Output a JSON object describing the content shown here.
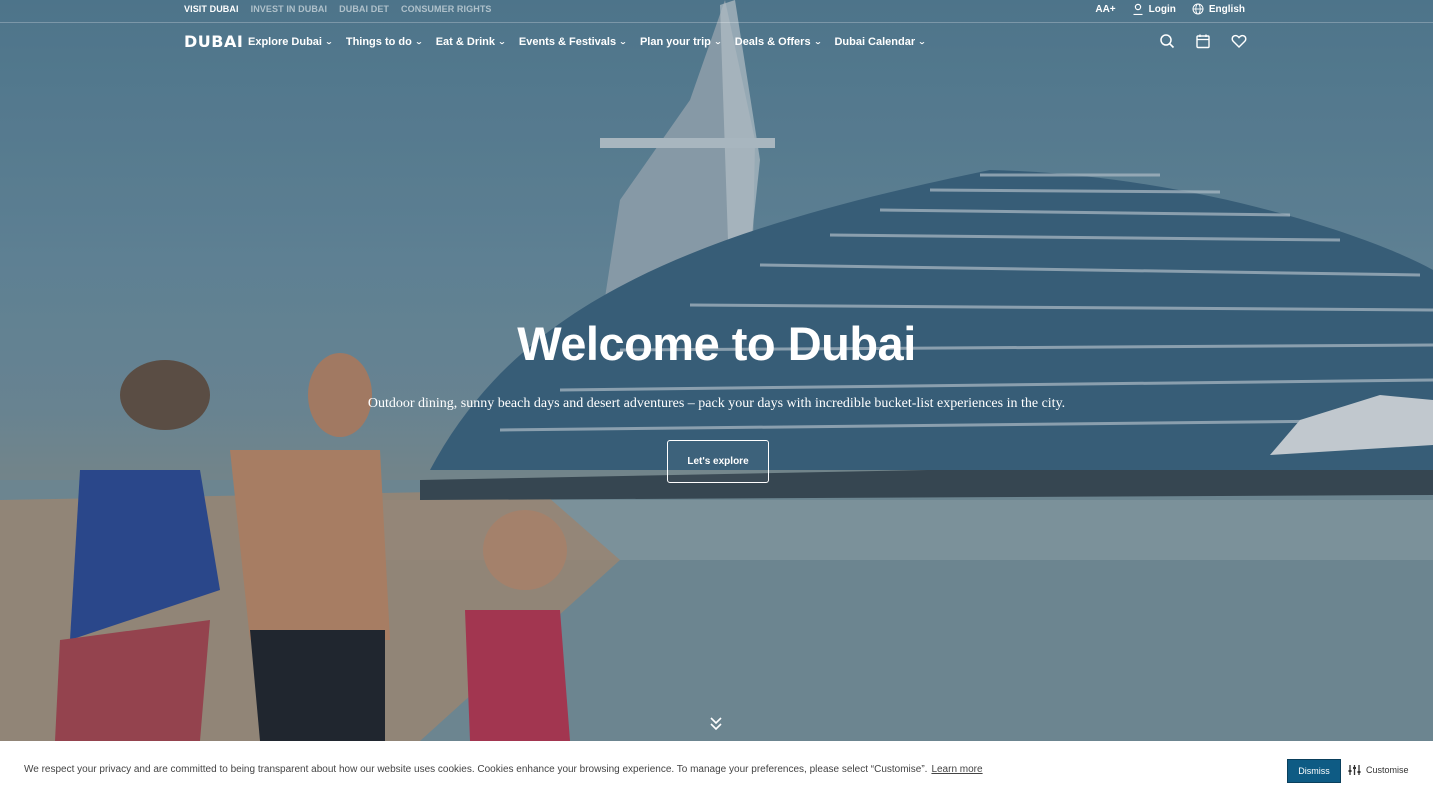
{
  "topbar": {
    "links": [
      "VISIT DUBAI",
      "INVEST IN DUBAI",
      "DUBAI DET",
      "CONSUMER RIGHTS"
    ],
    "text_size": "AA+",
    "login": "Login",
    "language": "English"
  },
  "nav": {
    "logo": "DUBAI",
    "items": [
      {
        "label": "Explore Dubai"
      },
      {
        "label": "Things to do"
      },
      {
        "label": "Eat & Drink"
      },
      {
        "label": "Events & Festivals"
      },
      {
        "label": "Plan your trip"
      },
      {
        "label": "Deals & Offers"
      },
      {
        "label": "Dubai Calendar"
      }
    ],
    "icons": [
      "search-icon",
      "calendar-icon",
      "heart-icon"
    ]
  },
  "hero": {
    "title": "Welcome to Dubai",
    "subtitle": "Outdoor dining, sunny beach days and desert adventures – pack your days with incredible bucket-list experiences in the city.",
    "cta": "Let's explore"
  },
  "cookie": {
    "message": "We respect your privacy and are committed to being transparent about how our website uses cookies. Cookies enhance your browsing experience. To manage your preferences, please select “Customise”.",
    "learn_more": "Learn more",
    "dismiss": "Dismiss",
    "customise": "Customise"
  },
  "colors": {
    "dismiss_bg": "#0e5b84",
    "hero_tint": "#5a869c"
  }
}
